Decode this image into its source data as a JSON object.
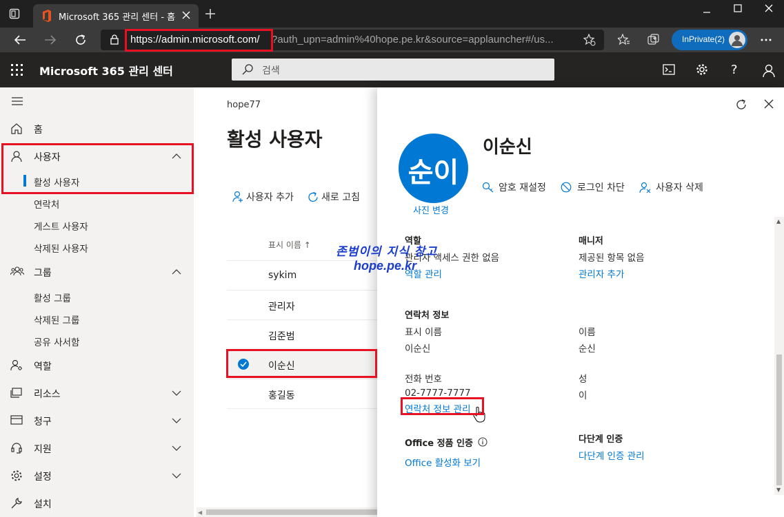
{
  "browser": {
    "tab_title": "Microsoft 365 관리 센터 - 홈",
    "url_host": "https://admin.microsoft.com/",
    "url_rest": "?auth_upn=admin%40hope.pe.kr&source=applauncher#/us...",
    "inprivate_label": "InPrivate(2)"
  },
  "header": {
    "title": "Microsoft 365 관리 센터",
    "search_placeholder": "검색"
  },
  "nav": {
    "home": "홈",
    "users": "사용자",
    "users_sub": [
      "활성 사용자",
      "연락처",
      "게스트 사용자",
      "삭제된 사용자"
    ],
    "groups": "그룹",
    "groups_sub": [
      "활성 그룹",
      "삭제된 그룹",
      "공유 사서함"
    ],
    "roles": "역할",
    "resources": "리소스",
    "billing": "청구",
    "support": "지원",
    "settings": "설정",
    "setup": "설치"
  },
  "main": {
    "tenant": "hope77",
    "title": "활성 사용자",
    "add_user": "사용자 추가",
    "refresh": "새로 고침",
    "col_display_name": "표시 이름 ↑",
    "users": [
      "sykim",
      "관리자",
      "김준범",
      "이순신",
      "홍길동"
    ]
  },
  "panel": {
    "initials": "순이",
    "photo_change": "사진 변경",
    "name": "이순신",
    "reset_password": "암호 재설정",
    "block_signin": "로그인 차단",
    "delete_user": "사용자 삭제",
    "roles_heading": "역할",
    "roles_value": "관리자 액세스 권한 없음",
    "roles_link": "역할 관리",
    "manager_heading": "매니저",
    "manager_value": "제공된 항목 없음",
    "manager_link": "관리자 추가",
    "contact_heading": "연락처 정보",
    "display_name_label": "표시 이름",
    "display_name_value": "이순신",
    "first_name_label": "이름",
    "first_name_value": "순신",
    "phone_label": "전화 번호",
    "phone_value": "02-7777-7777",
    "last_name_label": "성",
    "last_name_value": "이",
    "contact_link": "연락처 정보 관리",
    "office_heading": "Office 정품 인증",
    "office_link": "Office 활성화 보기",
    "mfa_heading": "다단계 인증",
    "mfa_link": "다단계 인증 관리"
  },
  "watermark": {
    "line1": "존범이의 지식 창고",
    "line2": "hope.pe.kr"
  },
  "colors": {
    "accent": "#0078d4",
    "highlight_box": "#e81123",
    "nav_background": "#f3f2f1",
    "header_background": "#252423"
  }
}
